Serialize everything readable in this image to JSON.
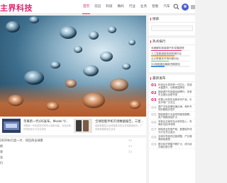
{
  "header": {
    "logo_text": "主界科技",
    "nav": [
      "首页",
      "前沿",
      "科技",
      "数码",
      "行业",
      "业务",
      "智能",
      "汽车"
    ]
  },
  "cards": [
    {
      "title": "苹果新一代iOS发布，Model Y/..",
      "desc": "苹果新一代系统发布带来大量新功能，包括全新的界面设计与交互体验"
    },
    {
      "title": "全球智能手机市场数据报告，三星...",
      "desc": "最新数据显示全球智能手机出货量继续增长，厂商竞争格局发生变化"
    }
  ],
  "list": {
    "rows": [
      {
        "title": "2020年打造一大  .  项目再全球第",
        "date": "22"
      },
      {
        "title": "前",
        "date": "22"
      },
      {
        "title": "发",
        "date": "22"
      },
      {
        "title": "告",
        "date": ""
      },
      {
        "title": "行",
        "date": ""
      },
      {
        "title": "",
        "date": ""
      },
      {
        "title": "",
        "date": ""
      }
    ]
  },
  "sidebar": {
    "search_title": "搜索",
    "bars_title": "热点排行",
    "bars": [
      {
        "label": "深度解析新能源汽车发展趋势",
        "value": 0.78,
        "color": "#e5206b"
      },
      {
        "label": "人工智能赋能传统制造行业",
        "value": 0.6,
        "color": "#f2a33a"
      },
      {
        "label": "云计算服务市场份额对比",
        "value": 0.45,
        "color": "#5bc06e"
      },
      {
        "label": "5G网络建设最新进展报告",
        "value": 0.35,
        "color": "#4a8fe0"
      }
    ],
    "news_title": "最新发布",
    "news": [
      {
        "num": "01",
        "text": "科技巨头发布新一代芯片，性能大幅提升，功耗明显降低"
      },
      {
        "num": "02",
        "text": "新能源汽车销量持续攀升，多家车企推出全新车型"
      },
      {
        "num": "03",
        "text": "苹果公司发布全新系列产品，引发市场广泛关注"
      },
      {
        "num": "04",
        "text": "国产手机品牌加速出海，海外市场份额稳步提升"
      },
      {
        "num": "05",
        "text": "智能家居行业迎来快速发展期，用户规模持续扩大"
      },
      {
        "num": "06",
        "text": "多家企业宣布加大研发投入，布局前沿技术领域"
      },
      {
        "num": "07",
        "text": "网络安全形势严峻，数据保护成为行业关注重点"
      },
      {
        "num": "08",
        "text": "全球半导体供应链调整，产业格局面临重塑"
      },
      {
        "num": "09",
        "text": "数字经济规模不断扩大，成为经济增长新引擎"
      }
    ]
  }
}
